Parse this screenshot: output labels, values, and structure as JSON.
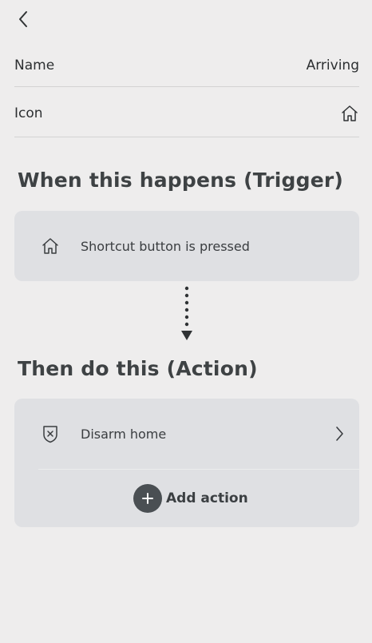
{
  "header": {
    "back_icon": "chevron-left-icon"
  },
  "settings": {
    "name_label": "Name",
    "name_value": "Arriving",
    "icon_label": "Icon",
    "icon_value": "home-icon"
  },
  "trigger": {
    "section_title": "When this happens (Trigger)",
    "item_label": "Shortcut button is pressed",
    "item_icon": "home-icon"
  },
  "action": {
    "section_title": "Then do this (Action)",
    "items": [
      {
        "label": "Disarm home",
        "icon": "shield-x-icon"
      }
    ],
    "add_label": "Add action",
    "add_icon": "plus-icon"
  },
  "colors": {
    "background": "#eeeded",
    "card": "#dfe0e3",
    "text": "#2e3133",
    "accent": "#4a4f53"
  }
}
